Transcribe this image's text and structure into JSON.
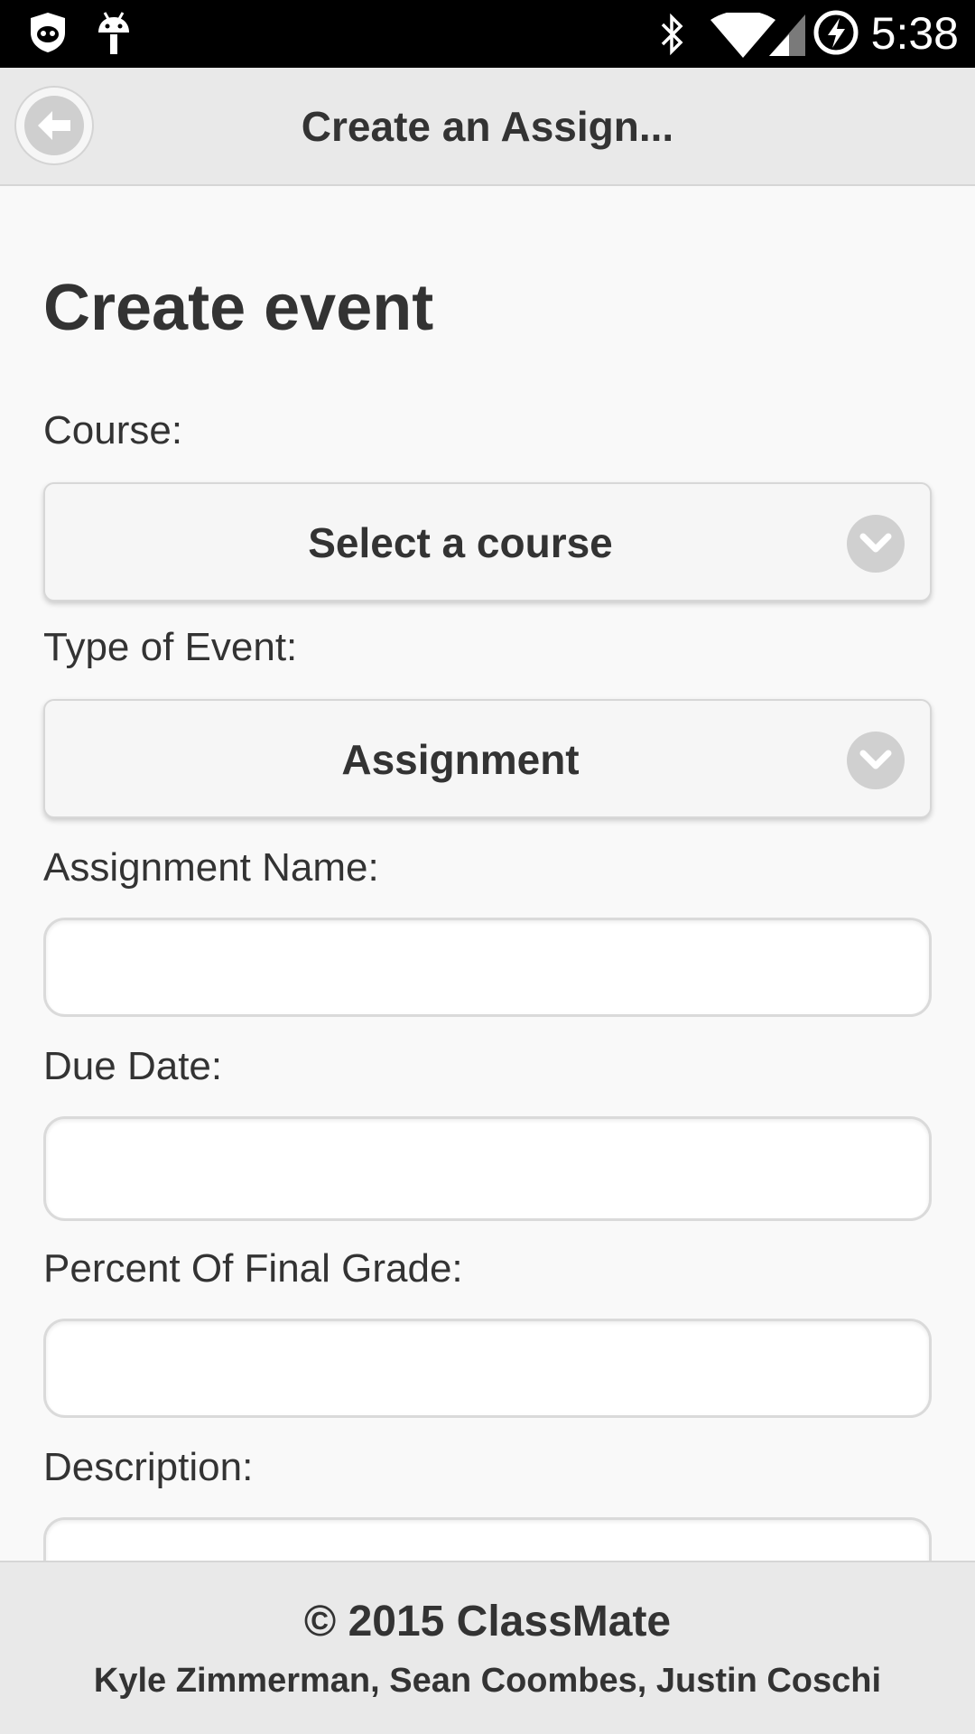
{
  "status_bar": {
    "time": "5:38",
    "left_icons": [
      "shield-cat-icon",
      "android-debug-icon"
    ],
    "right_icons": [
      "bluetooth-icon",
      "wifi-icon",
      "cell-signal-icon",
      "battery-charging-icon"
    ]
  },
  "header": {
    "title": "Create an Assign...",
    "back_icon": "arrow-left-circle-icon"
  },
  "page": {
    "title": "Create event"
  },
  "form": {
    "course": {
      "label": "Course:",
      "value": "Select a course"
    },
    "event_type": {
      "label": "Type of Event:",
      "value": "Assignment"
    },
    "assignment_name": {
      "label": "Assignment Name:",
      "value": ""
    },
    "due_date": {
      "label": "Due Date:",
      "value": ""
    },
    "percent_final_grade": {
      "label": "Percent Of Final Grade:",
      "value": ""
    },
    "description": {
      "label": "Description:",
      "value": ""
    }
  },
  "footer": {
    "copyright": "© 2015 ClassMate",
    "authors": "Kyle Zimmerman, Sean Coombes, Justin Coschi"
  },
  "colors": {
    "status_bar_bg": "#000000",
    "header_bg": "#e9e9e9",
    "page_bg": "#f9f9f9",
    "text": "#333333"
  }
}
